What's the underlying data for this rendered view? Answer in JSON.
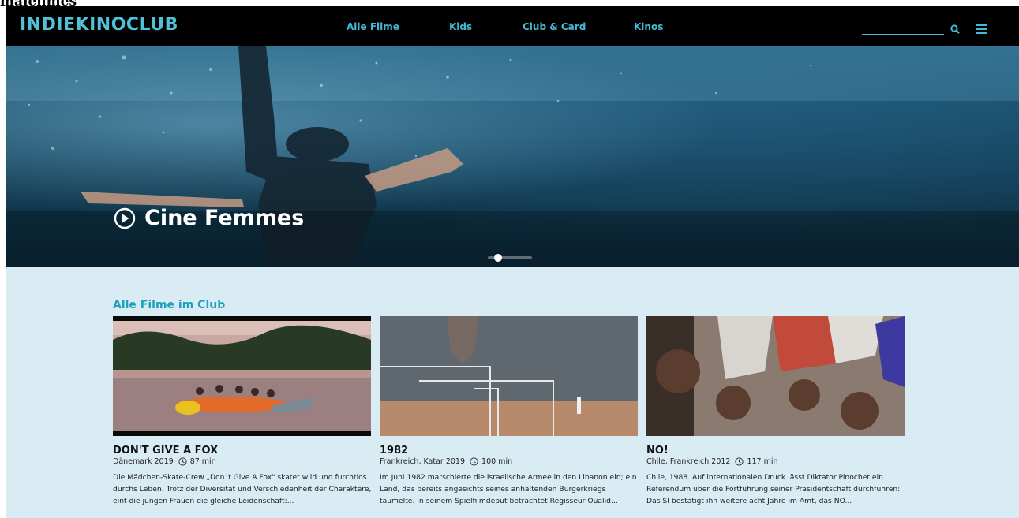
{
  "page_label": "malefimes",
  "nav": {
    "logo": "INDIEKINOCLUB",
    "links": [
      "Alle Filme",
      "Kids",
      "Club & Card",
      "Kinos"
    ],
    "search_placeholder": "",
    "accent_color": "#44b9d3"
  },
  "hero": {
    "title": "Cine Femmes",
    "icon": "play-circle-icon",
    "slider_active_index": 0,
    "slider_count": 2
  },
  "section": {
    "title": "Alle Filme im Club",
    "films": [
      {
        "title": "DON'T GIVE A FOX",
        "origin": "Dänemark 2019",
        "duration": "87 min",
        "description": "Die Mädchen-Skate-Crew „Don´t Give A Fox\" skatet wild und furchtlos durchs Leben. Trotz der Diversität und Verschiedenheit der Charaktere, eint die jungen Frauen die gleiche Leidenschaft:..."
      },
      {
        "title": "1982",
        "origin": "Frankreich, Katar 2019",
        "duration": "100 min",
        "description": "Im Juni 1982 marschierte die israelische Armee in den Libanon ein; ein Land, das bereits angesichts seines anhaltenden Bürgerkriegs taumelte. In seinem Spielfilmdebüt betrachtet Regisseur Oualid..."
      },
      {
        "title": "NO!",
        "origin": "Chile, Frankreich 2012",
        "duration": "117 min",
        "description": "Chile, 1988. Auf internationalen Druck lässt Diktator Pinochet ein Referendum über die Fortführung seiner Präsidentschaft durchführen: Das SI bestätigt ihn weitere acht Jahre im Amt, das NO..."
      }
    ]
  }
}
